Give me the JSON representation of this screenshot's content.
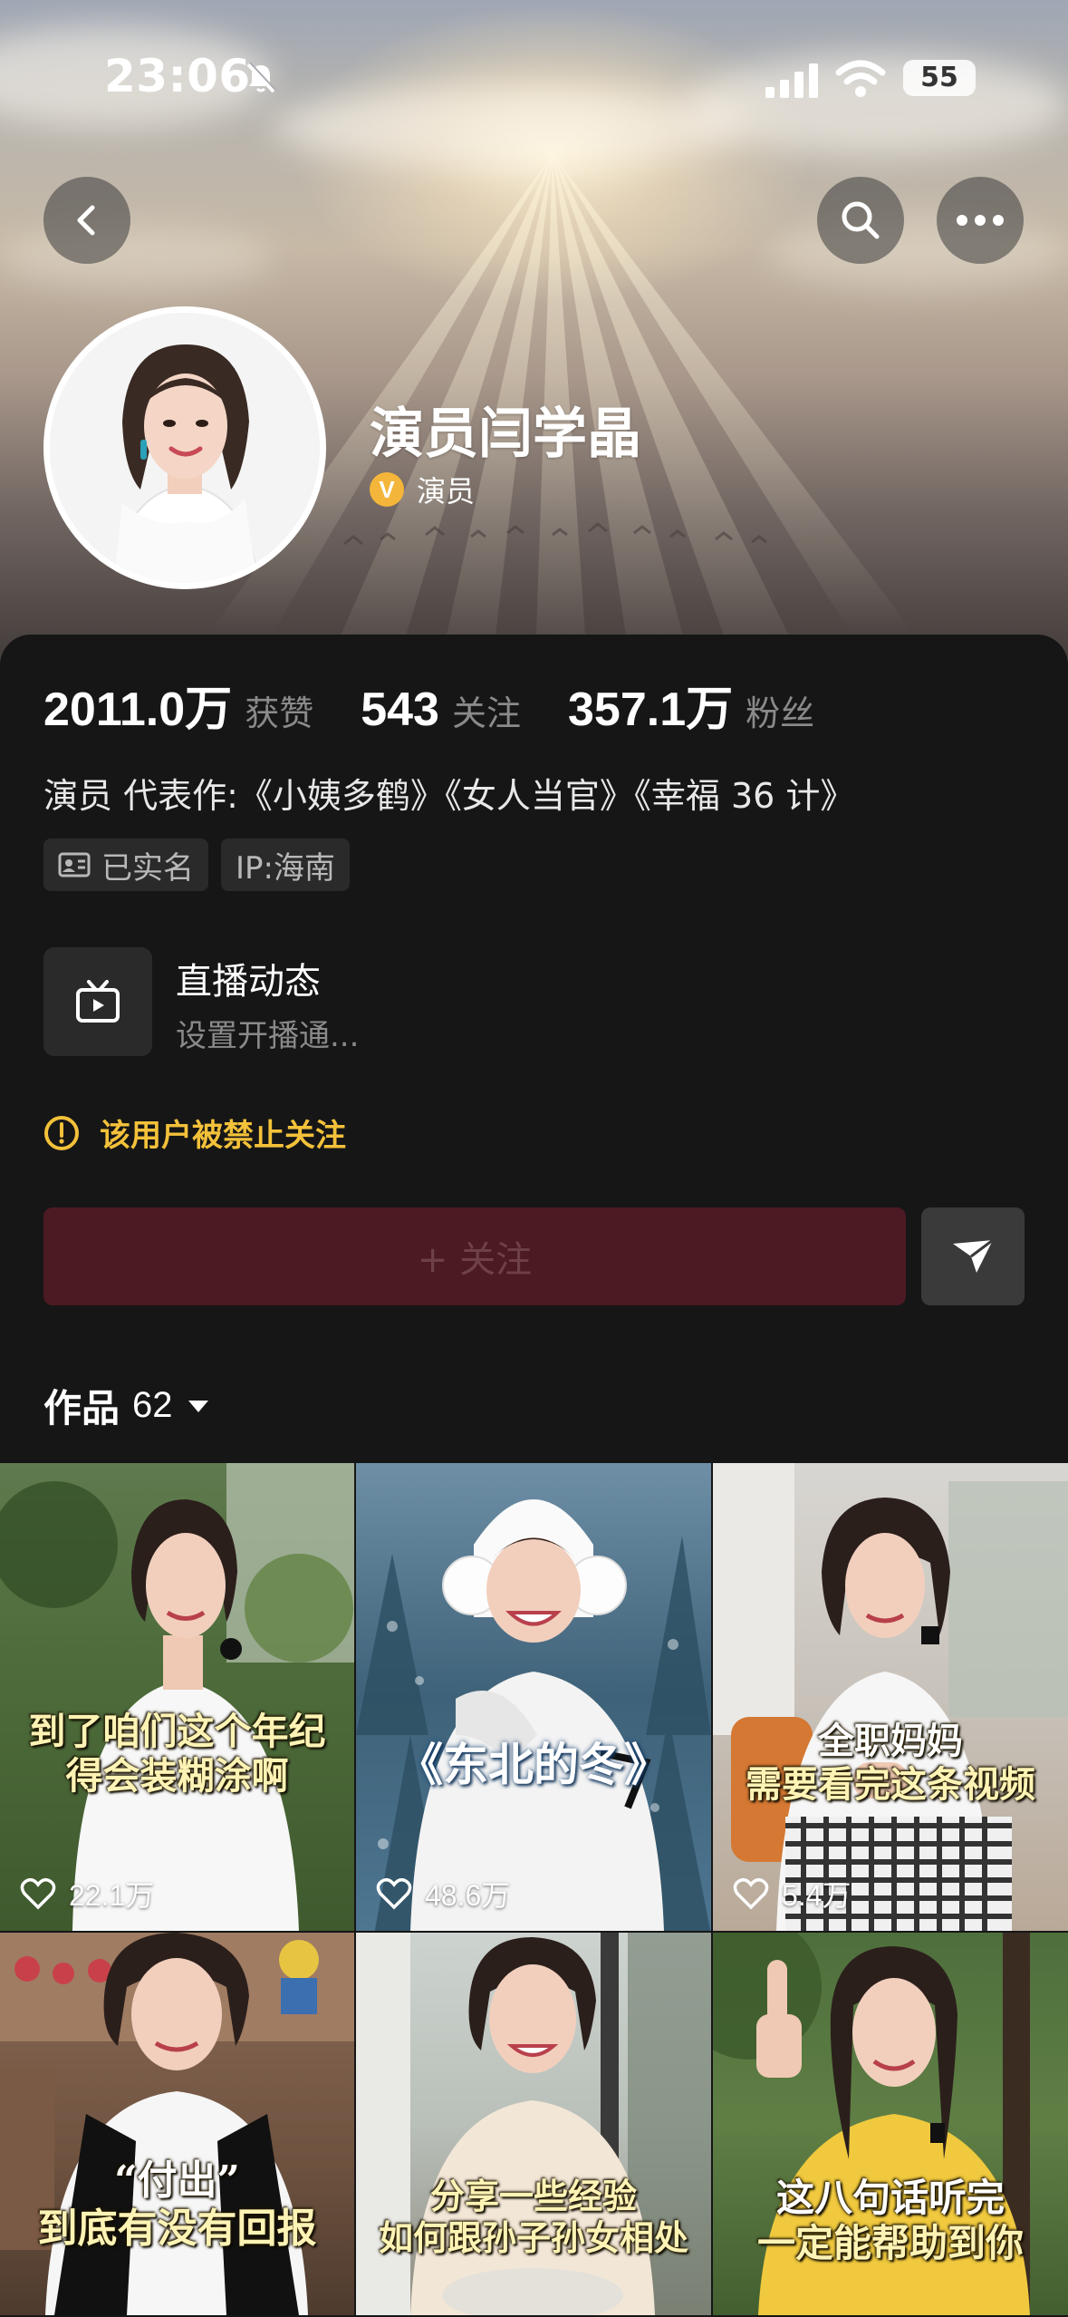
{
  "status_bar": {
    "time": "23:06",
    "battery": "55"
  },
  "profile": {
    "name": "演员闫学晶",
    "verified_label": "演员",
    "stats": [
      {
        "value": "2011.0万",
        "label": "获赞"
      },
      {
        "value": "543",
        "label": "关注"
      },
      {
        "value": "357.1万",
        "label": "粉丝"
      }
    ],
    "bio": "演员 代表作:《小姨多鹤》《女人当官》《幸福 36 计》",
    "tags": [
      {
        "label": "已实名",
        "icon": "id-card-icon"
      },
      {
        "label": "IP:海南",
        "icon": ""
      }
    ]
  },
  "live": {
    "title": "直播动态",
    "subtitle": "设置开播通..."
  },
  "warning": "该用户被禁止关注",
  "follow_label": "+ 关注",
  "works": {
    "label": "作品",
    "count": "62"
  },
  "videos": [
    {
      "caption_lines": [
        "到了咱们这个年纪",
        "得会装糊涂啊"
      ],
      "likes": "22.1万"
    },
    {
      "caption_lines": [
        "《东北的冬》"
      ],
      "likes": "48.6万"
    },
    {
      "caption_lines": [
        "全职妈妈",
        "需要看完这条视频"
      ],
      "likes": "5.4万"
    },
    {
      "caption_lines": [
        "“付出”",
        "到底有没有回报"
      ],
      "likes": ""
    },
    {
      "caption_lines": [
        "分享一些经验",
        "如何跟孙子孙女相处"
      ],
      "likes": ""
    },
    {
      "caption_lines": [
        "这八句话听完",
        "一定能帮助到你"
      ],
      "likes": ""
    }
  ],
  "colors": {
    "background": "#161616",
    "follow_disabled": "#4c1a22",
    "warning": "#f3c13a",
    "verify_badge": "#f4b63a",
    "muted_text": "#8a8a8a"
  }
}
